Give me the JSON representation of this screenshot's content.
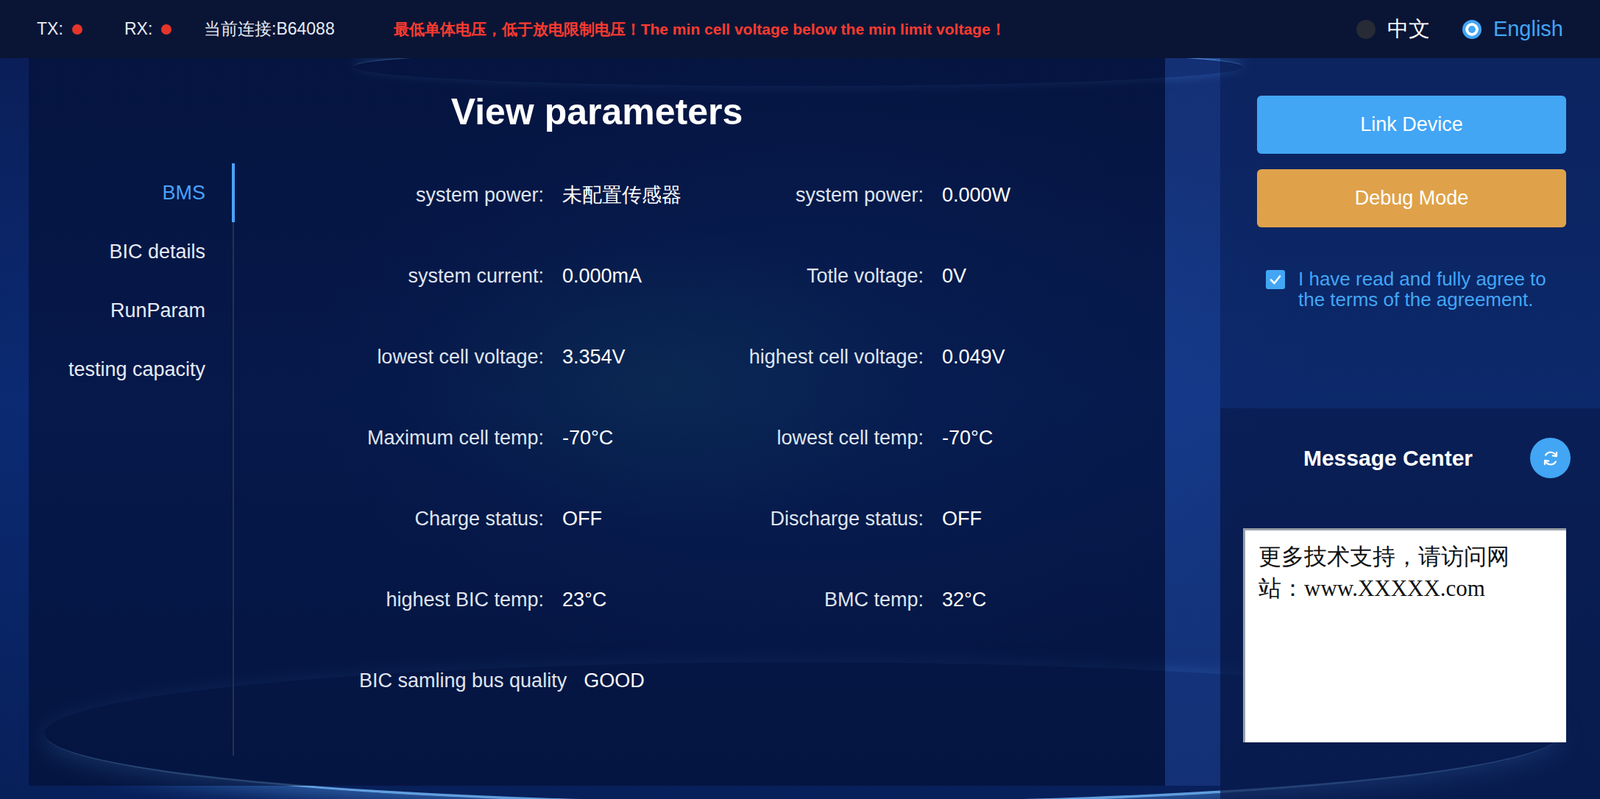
{
  "status_bar": {
    "indicators": [
      {
        "label": "TX:",
        "lit": true
      },
      {
        "label": "RX:",
        "lit": true
      }
    ],
    "connection": "当前连接:B64088",
    "alarm": "最低单体电压，低于放电限制电压！The min cell voltage below the min limit voltage！",
    "languages": [
      {
        "label": "中文",
        "selected": false
      },
      {
        "label": "English",
        "selected": true
      }
    ]
  },
  "sidebar": {
    "items": [
      {
        "label": "BMS",
        "selected": true
      },
      {
        "label": "BIC details",
        "selected": false
      },
      {
        "label": "RunParam",
        "selected": false
      },
      {
        "label": "testing capacity",
        "selected": false
      }
    ]
  },
  "title": "View parameters",
  "parameters": [
    {
      "label": "system power:",
      "value": "未配置传感器",
      "kind": "pair"
    },
    {
      "label": "system power:",
      "value": "0.000W",
      "kind": "pair"
    },
    {
      "label": "system current:",
      "value": "0.000mA",
      "kind": "pair"
    },
    {
      "label": "Totle voltage:",
      "value": "0V",
      "kind": "pair"
    },
    {
      "label": "lowest cell voltage:",
      "value": "3.354V",
      "kind": "pair"
    },
    {
      "label": "highest cell voltage:",
      "value": "0.049V",
      "kind": "pair"
    },
    {
      "label": "Maximum cell temp:",
      "value": "-70°C",
      "kind": "pair"
    },
    {
      "label": "lowest cell temp:",
      "value": "-70°C",
      "kind": "pair"
    },
    {
      "label": "Charge status:",
      "value": "OFF",
      "kind": "pair"
    },
    {
      "label": "Discharge status:",
      "value": "OFF",
      "kind": "pair"
    },
    {
      "label": "highest BIC temp:",
      "value": "23°C",
      "kind": "pair"
    },
    {
      "label": "BMC temp:",
      "value": "32°C",
      "kind": "pair"
    },
    {
      "label": "BIC samling bus quality",
      "value": "GOOD",
      "kind": "wide"
    }
  ],
  "actions": [
    {
      "label": "Link Device",
      "kind": "primary"
    },
    {
      "label": "Debug Mode",
      "kind": "warning"
    }
  ],
  "agreement": {
    "text": "I have read and fully agree to the terms of the agreement.",
    "checked": true
  },
  "message_center": {
    "title": "Message Center",
    "messages": [
      "更多技术支持，请访问网站：www.XXXXX.com"
    ]
  }
}
